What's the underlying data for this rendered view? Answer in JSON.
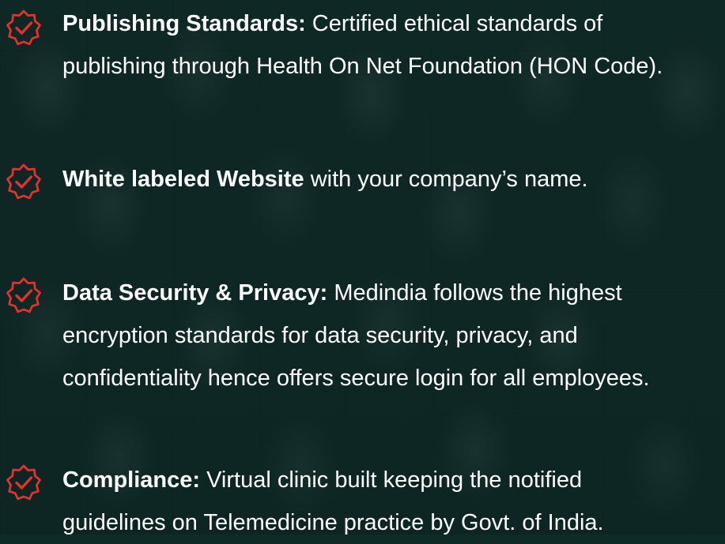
{
  "colors": {
    "background": "#0f2b28",
    "icon_accent": "#e4322b",
    "text": "#ffffff"
  },
  "items": [
    {
      "icon": "verified-badge-icon",
      "title": "Publishing Standards:",
      "line1": " Certified ethical standards of",
      "line2": "publishing through Health On Net Foundation (HON Code)."
    },
    {
      "icon": "verified-badge-icon",
      "title": "White labeled Website",
      "line1": " with your company’s name."
    },
    {
      "icon": "verified-badge-icon",
      "title": "Data Security & Privacy:",
      "line1": " Medindia follows the highest",
      "line2": "encryption standards for data security, privacy, and",
      "line3": "confidentiality hence offers secure login for all employees."
    },
    {
      "icon": "verified-badge-icon",
      "title": "Compliance:",
      "line1": " Virtual clinic built keeping the notified",
      "line2": "guidelines on Telemedicine practice by Govt. of India."
    }
  ]
}
